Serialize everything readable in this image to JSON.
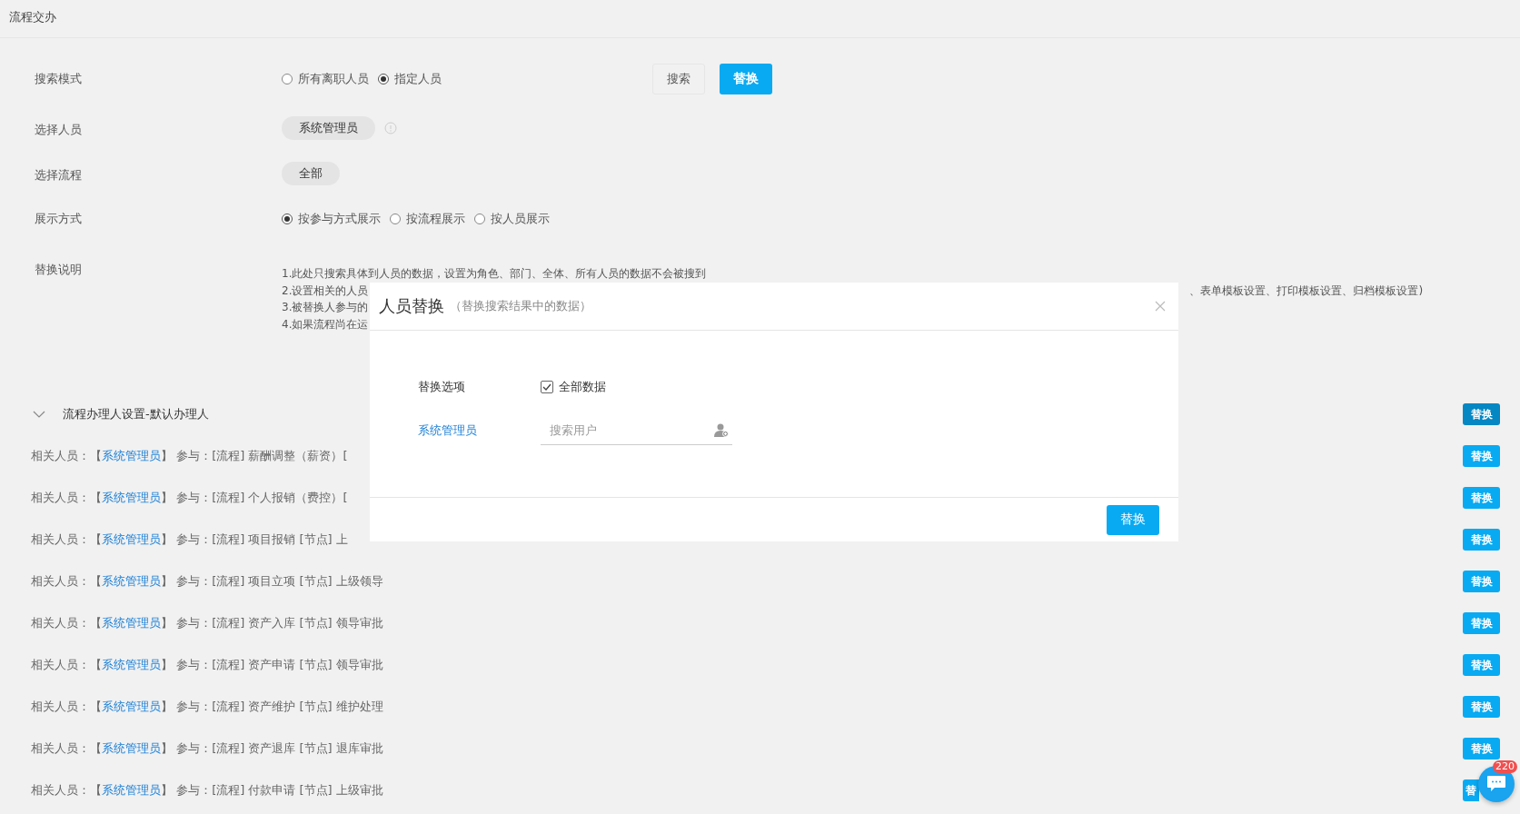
{
  "page_title": "流程交办",
  "form": {
    "search_mode": {
      "label": "搜索模式",
      "options": [
        {
          "label": "所有离职人员",
          "selected": false
        },
        {
          "label": "指定人员",
          "selected": true
        }
      ]
    },
    "search_button": "搜索",
    "replace_button": "替换",
    "select_person": {
      "label": "选择人员",
      "value": "系统管理员"
    },
    "select_flow": {
      "label": "选择流程",
      "value": "全部"
    },
    "display_mode": {
      "label": "展示方式",
      "options": [
        {
          "label": "按参与方式展示",
          "selected": true
        },
        {
          "label": "按流程展示",
          "selected": false
        },
        {
          "label": "按人员展示",
          "selected": false
        }
      ]
    },
    "notes": {
      "label": "替换说明",
      "lines": [
        {
          "left": "1.此处只搜索具体到人员的数据，设置为角色、部门、全体、所有人员的数据不会被搜到"
        },
        {
          "left": "2.设置相关的人员",
          "right": "、表单模板设置、打印模板设置、归档模板设置)"
        },
        {
          "left": "3.被替换人参与的"
        },
        {
          "left": "4.如果流程尚在运"
        }
      ]
    }
  },
  "section": {
    "title": "流程办理人设置-默认办理人",
    "expanded": true,
    "button": "替换",
    "hovered": true
  },
  "rows": [
    {
      "before": "相关人员：【",
      "person": "系统管理员",
      "after": "】 参与：[流程] 薪酬调整（薪资）[",
      "button": "替换",
      "hovered": false
    },
    {
      "before": "相关人员：【",
      "person": "系统管理员",
      "after": "】 参与：[流程] 个人报销（费控）[",
      "button": "替换",
      "hovered": false
    },
    {
      "before": "相关人员：【",
      "person": "系统管理员",
      "after": "】 参与：[流程] 项目报销 [节点] 上",
      "button": "替换",
      "hovered": false
    },
    {
      "before": "相关人员：【",
      "person": "系统管理员",
      "after": "】 参与：[流程] 项目立项 [节点] 上级领导",
      "button": "替换",
      "hovered": false
    },
    {
      "before": "相关人员：【",
      "person": "系统管理员",
      "after": "】 参与：[流程] 资产入库 [节点] 领导审批",
      "button": "替换",
      "hovered": false
    },
    {
      "before": "相关人员：【",
      "person": "系统管理员",
      "after": "】 参与：[流程] 资产申请 [节点] 领导审批",
      "button": "替换",
      "hovered": false
    },
    {
      "before": "相关人员：【",
      "person": "系统管理员",
      "after": "】 参与：[流程] 资产维护 [节点] 维护处理",
      "button": "替换",
      "hovered": false
    },
    {
      "before": "相关人员：【",
      "person": "系统管理员",
      "after": "】 参与：[流程] 资产退库 [节点] 退库审批",
      "button": "替换",
      "hovered": false
    },
    {
      "before": "相关人员：【",
      "person": "系统管理员",
      "after": "】 参与：[流程] 付款申请 [节点] 上级审批",
      "button": "替",
      "hovered": false
    }
  ],
  "modal": {
    "title": "人员替换",
    "subtitle": "（替换搜索结果中的数据）",
    "option_label": "替换选项",
    "checkbox": {
      "label": "全部数据",
      "checked": true
    },
    "person": "系统管理员",
    "search_placeholder": "搜索用户",
    "button": "替换"
  },
  "chat": {
    "badge": "220"
  }
}
